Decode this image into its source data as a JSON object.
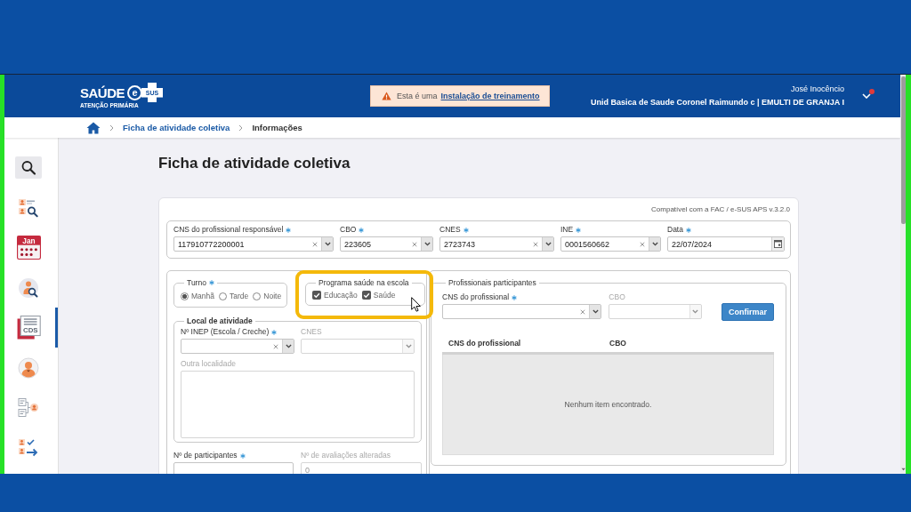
{
  "header": {
    "logo": {
      "word": "SAÚDE",
      "mark_letter": "e",
      "mark_badge": "SUS",
      "tagline": "ATENÇÃO PRIMÁRIA"
    },
    "notice": {
      "text": "Esta é uma",
      "link": "Instalação de treinamento"
    },
    "user": {
      "name": "José Inocêncio",
      "unit": "Unid Basica de Saude Coronel Raimundo c | EMULTI DE GRANJA I",
      "has_alert": true
    }
  },
  "breadcrumb": [
    {
      "label": "Ficha de atividade coletiva",
      "kind": "link"
    },
    {
      "label": "Informações",
      "kind": "current"
    }
  ],
  "sidebar": {
    "items": [
      {
        "kind": "search",
        "selected": false
      },
      {
        "kind": "people-search",
        "selected": false
      },
      {
        "kind": "calendar",
        "badge": "Jan",
        "selected": false
      },
      {
        "kind": "person-search",
        "selected": false
      },
      {
        "kind": "document",
        "badge": "CDS",
        "selected": true
      },
      {
        "kind": "person",
        "selected": false
      },
      {
        "kind": "records",
        "selected": false
      },
      {
        "kind": "transfer",
        "selected": false
      }
    ]
  },
  "page": {
    "title": "Ficha de atividade coletiva"
  },
  "form": {
    "note": "Compatível com a FAC / e-SUS APS v.3.2.0",
    "header_fields": [
      {
        "label": "CNS do profissional responsável",
        "required": true,
        "disabled": false,
        "kind": "combo",
        "value": "117910772200001"
      },
      {
        "label": "CBO",
        "required": true,
        "disabled": false,
        "kind": "combo",
        "value": "223605"
      },
      {
        "label": "CNES",
        "required": true,
        "disabled": false,
        "kind": "combo",
        "value": "2723743"
      },
      {
        "label": "INE",
        "required": true,
        "disabled": false,
        "kind": "combo",
        "value": "0001560662"
      },
      {
        "label": "Data",
        "required": true,
        "disabled": false,
        "kind": "date",
        "value": "22/07/2024"
      }
    ],
    "shift": {
      "legend": "Turno",
      "required": true,
      "options": [
        {
          "label": "Manhã",
          "selected": true
        },
        {
          "label": "Tarde",
          "selected": false
        },
        {
          "label": "Noite",
          "selected": false
        }
      ]
    },
    "school_program": {
      "legend": "Programa saúde na escola",
      "highlighted": true,
      "options": [
        {
          "label": "Educação",
          "checked": true
        },
        {
          "label": "Saúde",
          "checked": true
        }
      ]
    },
    "location": {
      "legend": "Local de atividade",
      "fields": [
        {
          "label": "Nº INEP (Escola / Creche)",
          "required": true,
          "disabled": false,
          "kind": "combo"
        },
        {
          "label": "CNES",
          "required": false,
          "disabled": true,
          "kind": "select"
        },
        {
          "label": "Outra localidade",
          "required": false,
          "disabled": true,
          "kind": "textarea"
        }
      ]
    },
    "counts": [
      {
        "label": "Nº de participantes",
        "required": true,
        "disabled": false
      },
      {
        "label": "Nº de avaliações alteradas",
        "required": false,
        "disabled": true,
        "value": "0"
      }
    ],
    "professionals": {
      "legend": "Profissionais participantes",
      "fields": [
        {
          "label": "CNS do profissional",
          "required": true,
          "disabled": false,
          "kind": "combo"
        },
        {
          "label": "CBO",
          "required": false,
          "disabled": true,
          "kind": "select"
        }
      ],
      "button": "Confirmar",
      "table": {
        "columns": [
          "CNS do profissional",
          "CBO"
        ],
        "empty_text": "Nenhum item encontrado."
      }
    }
  }
}
